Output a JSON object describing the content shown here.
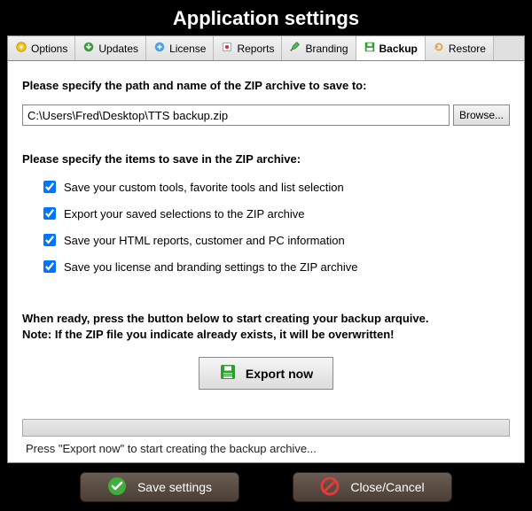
{
  "title": "Application settings",
  "tabs": [
    {
      "label": "Options"
    },
    {
      "label": "Updates"
    },
    {
      "label": "License"
    },
    {
      "label": "Reports"
    },
    {
      "label": "Branding"
    },
    {
      "label": "Backup"
    },
    {
      "label": "Restore"
    }
  ],
  "active_tab": "Backup",
  "path_label": "Please specify the path and name of the ZIP archive to save to:",
  "path_value": "C:\\Users\\Fred\\Desktop\\TTS backup.zip",
  "browse_label": "Browse...",
  "items_label": "Please specify the items to save in the ZIP archive:",
  "checks": [
    {
      "label": "Save your custom tools, favorite tools and list selection",
      "checked": true
    },
    {
      "label": "Export your saved selections to the ZIP archive",
      "checked": true
    },
    {
      "label": "Save your HTML reports, customer and PC information",
      "checked": true
    },
    {
      "label": "Save you license and branding settings to the ZIP archive",
      "checked": true
    }
  ],
  "ready_line1": "When ready, press the button below to start creating your backup arquive.",
  "ready_line2": "Note: If the ZIP file you indicate already exists, it will be overwritten!",
  "export_label": "Export now",
  "status_text": "Press \"Export now\" to start creating the backup archive...",
  "save_label": "Save settings",
  "cancel_label": "Close/Cancel"
}
